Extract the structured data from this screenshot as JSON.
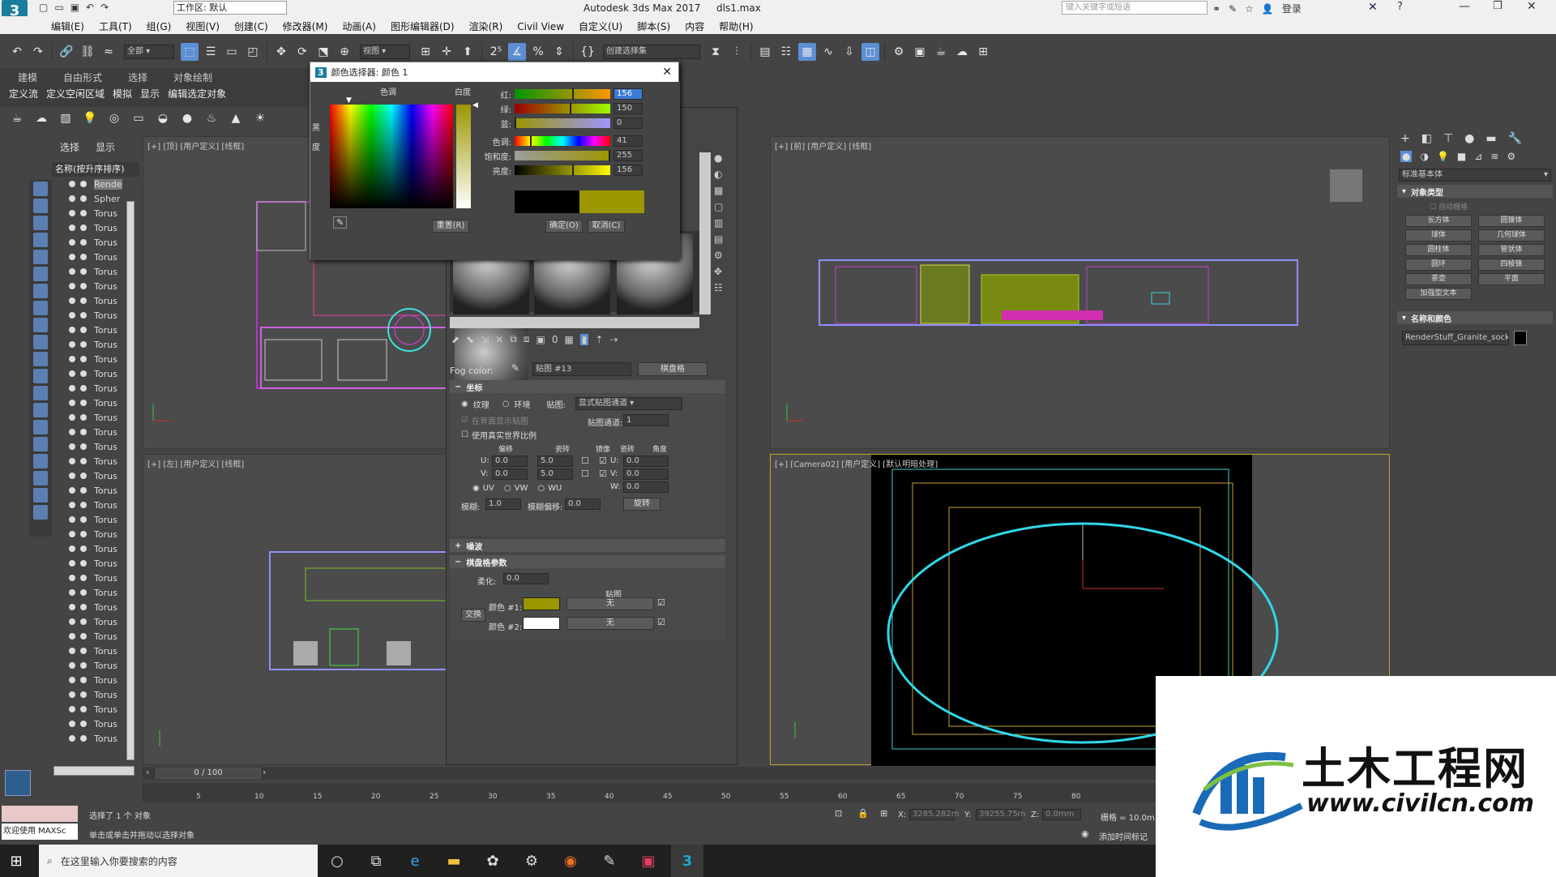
{
  "titlebar": {
    "workspace": "工作区: 默认",
    "app_title": "Autodesk 3ds Max 2017",
    "file_name": "dls1.max",
    "search_placeholder": "键入关键字或短语",
    "login": "登录"
  },
  "menu": [
    "编辑(E)",
    "工具(T)",
    "组(G)",
    "视图(V)",
    "创建(C)",
    "修改器(M)",
    "动画(A)",
    "图形编辑器(D)",
    "渲染(R)",
    "Civil View",
    "自定义(U)",
    "脚本(S)",
    "内容",
    "帮助(H)"
  ],
  "toolbar": {
    "select_filter": "全部",
    "ref_coord": "视图",
    "named_sel": "创建选择集"
  },
  "ribbon_tabs": [
    "建模",
    "自由形式",
    "选择",
    "对象绘制"
  ],
  "ribbon_tabs2": [
    "定义流",
    "定义空闲区域",
    "模拟",
    "显示",
    "编辑选定对象"
  ],
  "scene_explorer": {
    "tabs": [
      "选择",
      "显示"
    ],
    "header": "名称(按升序排序)",
    "items": [
      "Rende",
      "Spher",
      "Torus",
      "Torus",
      "Torus",
      "Torus",
      "Torus",
      "Torus",
      "Torus",
      "Torus",
      "Torus",
      "Torus",
      "Torus",
      "Torus",
      "Torus",
      "Torus",
      "Torus",
      "Torus",
      "Torus",
      "Torus",
      "Torus",
      "Torus",
      "Torus",
      "Torus",
      "Torus",
      "Torus",
      "Torus",
      "Torus",
      "Torus",
      "Torus",
      "Torus",
      "Torus",
      "Torus",
      "Torus",
      "Torus",
      "Torus",
      "Torus",
      "Torus",
      "Torus",
      "Torus"
    ]
  },
  "viewports": {
    "top": "[+] [顶] [用户定义] [线框]",
    "front": "[+] [前] [用户定义] [线框]",
    "left": "[+] [左] [用户定义] [线框]",
    "camera": "[+] [Camera02] [用户定义] [默认明暗处理]"
  },
  "color_picker": {
    "title": "颜色选择器: 颜色 1",
    "hue_label": "色调",
    "white_label": "白度",
    "black_label": "黑",
    "degree_label": "度",
    "rows": [
      {
        "label": "红:",
        "value": "156"
      },
      {
        "label": "绿:",
        "value": "150"
      },
      {
        "label": "蓝:",
        "value": "0"
      },
      {
        "label": "色调:",
        "value": "41"
      },
      {
        "label": "饱和度:",
        "value": "255"
      },
      {
        "label": "亮度:",
        "value": "156"
      }
    ],
    "reset": "重置(R)",
    "ok": "确定(O)",
    "cancel": "取消(C)",
    "old_color": "#000000",
    "new_color": "#9c9600"
  },
  "material_editor": {
    "fog_label": "Fog color:",
    "map_name": "贴图 #13",
    "map_type": "棋盘格",
    "coords_title": "坐标",
    "texture": "纹理",
    "environ": "环境",
    "mapping_label": "贴图:",
    "mapping_value": "显式贴图通道",
    "show_map_back": "在背面显示贴图",
    "map_channel_label": "贴图通道:",
    "map_channel_value": "1",
    "real_world": "使用真实世界比例",
    "col_offset": "偏移",
    "col_tiling": "瓷砖",
    "col_mirror": "镜像",
    "col_tile": "瓷砖",
    "col_angle": "角度",
    "u_label": "U:",
    "v_label": "V:",
    "w_label": "W:",
    "u_offset": "0.0",
    "v_offset": "0.0",
    "u_tiling": "5.0",
    "v_tiling": "5.0",
    "u_angle": "0.0",
    "v_angle": "0.0",
    "w_angle": "0.0",
    "uv": "UV",
    "vw": "VW",
    "wu": "WU",
    "blur_label": "模糊:",
    "blur_value": "1.0",
    "blur_offset_label": "模糊偏移:",
    "blur_offset_value": "0.0",
    "rotate": "旋转",
    "noise_title": "噪波",
    "checker_title": "棋盘格参数",
    "soften_label": "柔化:",
    "soften_value": "0.0",
    "maps_label": "贴图",
    "swap": "交换",
    "color1_label": "颜色 #1:",
    "color2_label": "颜色 #2:",
    "none": "无",
    "color1": "#9c9600",
    "color2": "#ffffff"
  },
  "command_panel": {
    "dropdown": "标准基本体",
    "object_type_title": "对象类型",
    "autogrid": "自动栅格",
    "buttons": [
      "长方体",
      "圆锥体",
      "球体",
      "几何球体",
      "圆柱体",
      "管状体",
      "圆环",
      "四棱锥",
      "茶壶",
      "平面",
      "加强型文本"
    ],
    "name_color_title": "名称和颜色",
    "name_value": "RenderStuff_Granite_sock"
  },
  "timeline": {
    "frame": "0 / 100",
    "ticks": [
      "5",
      "10",
      "15",
      "20",
      "25",
      "30",
      "35",
      "40",
      "45",
      "50",
      "55",
      "60",
      "65",
      "70",
      "75",
      "80"
    ]
  },
  "status": {
    "welcome": "欢迎使用 MAXSc",
    "selected": "选择了 1 个 对象",
    "prompt": "单击或单击并拖动以选择对象",
    "x_label": "X:",
    "x_value": "3285.282m",
    "y_label": "Y:",
    "y_value": "39255.75m",
    "z_label": "Z:",
    "z_value": "0.0mm",
    "grid": "栅格 = 10.0m",
    "add_time_tag": "添加时间标记"
  },
  "taskbar": {
    "search_placeholder": "在这里输入你要搜索的内容"
  },
  "watermark": {
    "brand": "土木工程网",
    "url": "www.civilcn.com"
  }
}
